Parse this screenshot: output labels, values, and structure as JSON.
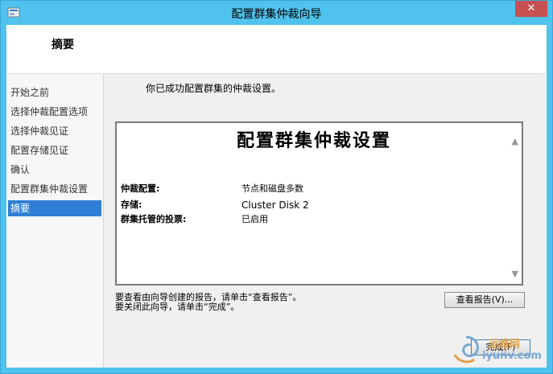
{
  "window": {
    "title": "配置群集仲裁向导",
    "close_label": "✕"
  },
  "header": {
    "page_title": "摘要"
  },
  "nav": {
    "items": [
      {
        "label": "开始之前",
        "active": false
      },
      {
        "label": "选择仲裁配置选项",
        "active": false
      },
      {
        "label": "选择仲裁见证",
        "active": false
      },
      {
        "label": "配置存储见证",
        "active": false
      },
      {
        "label": "确认",
        "active": false
      },
      {
        "label": "配置群集仲裁设置",
        "active": false
      },
      {
        "label": "摘要",
        "active": true
      }
    ]
  },
  "main": {
    "intro": "你已成功配置群集的仲裁设置。",
    "report": {
      "heading": "配置群集仲裁设置",
      "rows": [
        {
          "key": "仲裁配置:",
          "value": "节点和磁盘多数"
        },
        {
          "key": "存储:",
          "value": "Cluster Disk 2"
        },
        {
          "key": "群集托管的投票:",
          "value": "已启用"
        }
      ]
    },
    "hint_line1": "要查看由向导创建的报告，请单击“查看报告”。",
    "hint_line2": "要关闭此向导，请单击“完成”。",
    "view_report_label": "查看报告(V)...",
    "finish_label": "完成(F)"
  },
  "watermark": {
    "line1": "运维网",
    "line2": "iyunv.com"
  }
}
